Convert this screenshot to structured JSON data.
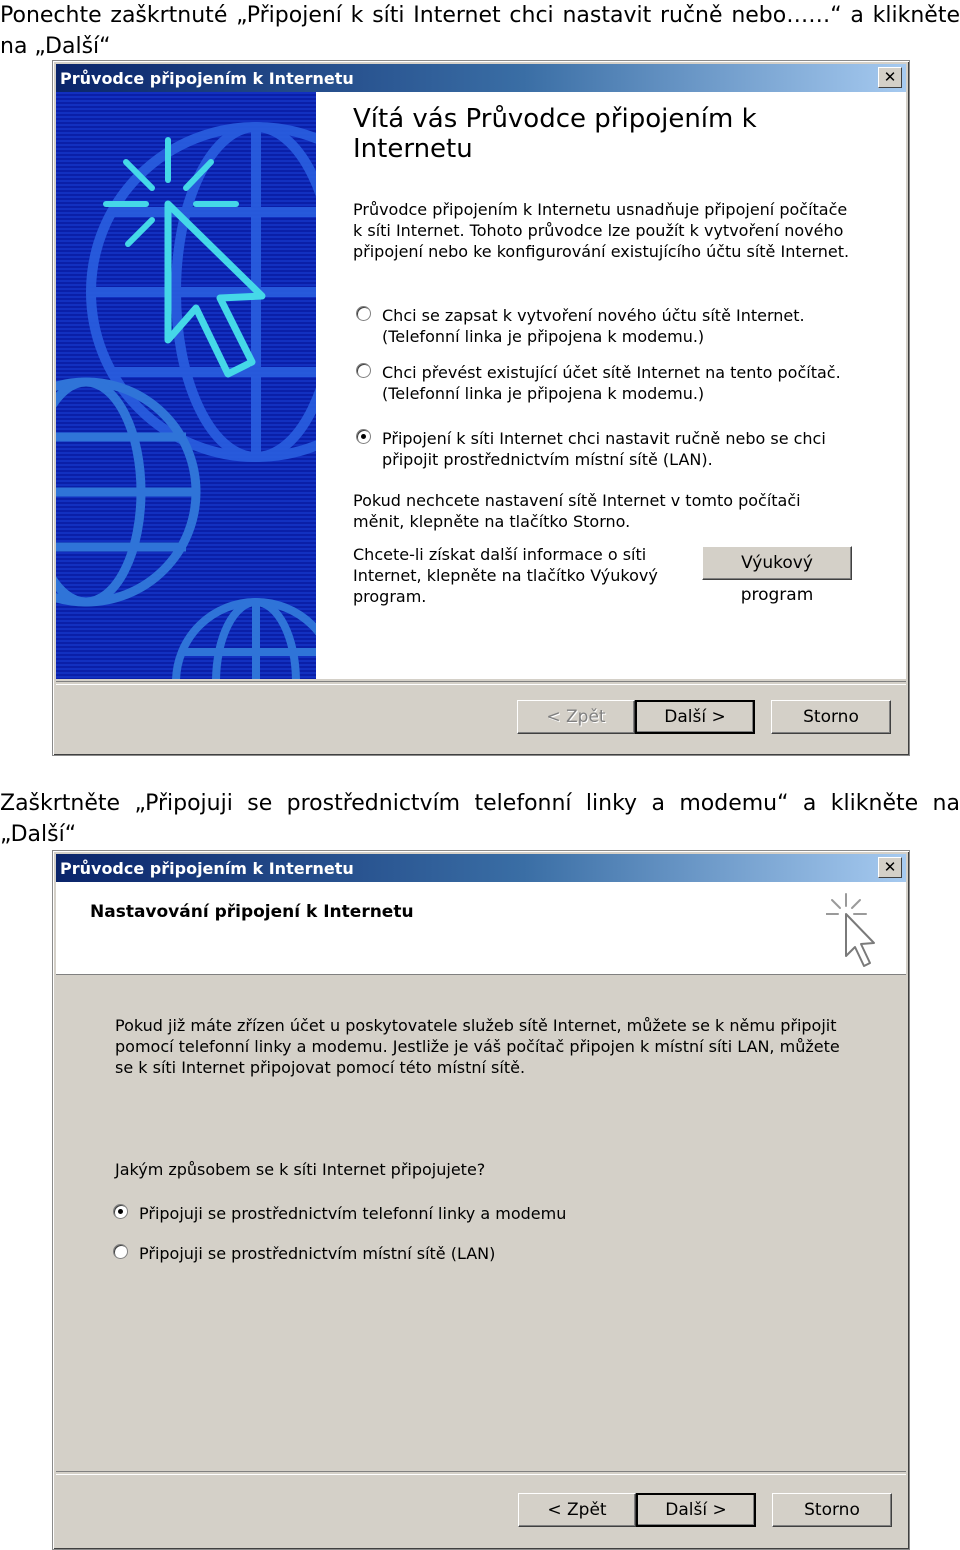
{
  "captions": {
    "first": "Ponechte zaškrtnuté „Připojení k síti Internet chci nastavit ručně nebo……“ a klikněte na „Další“",
    "second": "Zaškrtněte „Připojuji se prostřednictvím telefonní linky a modemu“ a klikněte na „Další“"
  },
  "window1": {
    "title": "Průvodce připojením k Internetu",
    "close": "✕",
    "heading": "Vítá vás Průvodce připojením k Internetu",
    "intro": "Průvodce připojením k Internetu usnadňuje připojení počítače k síti Internet. Tohoto průvodce lze použít k vytvoření nového připojení nebo ke konfigurování existujícího účtu sítě Internet.",
    "options": [
      {
        "line1": "Chci se zapsat k vytvoření nového účtu sítě Internet.",
        "line2": "(Telefonní linka je připojena k modemu.)",
        "selected": false
      },
      {
        "line1": "Chci převést existující účet sítě Internet na tento počítač.",
        "line2": "(Telefonní linka je připojena k modemu.)",
        "selected": false
      },
      {
        "line1": "Připojení k síti Internet chci nastavit ručně nebo se chci",
        "line2": "připojit prostřednictvím místní sítě (LAN).",
        "selected": true
      }
    ],
    "cancel_note": "Pokud nechcete nastavení sítě Internet v tomto počítači měnit, klepněte na tlačítko Storno.",
    "tutorial_note": "Chcete-li získat další informace o síti Internet, klepněte na tlačítko Výukový program.",
    "tutorial_button": "Výukový program",
    "buttons": {
      "back": "< Zpět",
      "next": "Další >",
      "cancel": "Storno"
    }
  },
  "window2": {
    "title": "Průvodce připojením k Internetu",
    "close": "✕",
    "header": "Nastavování připojení k Internetu",
    "description": "Pokud již máte zřízen účet u poskytovatele služeb sítě Internet, můžete se k němu připojit pomocí telefonní linky a modemu. Jestliže je váš počítač připojen k místní síti LAN, můžete se k síti Internet připojovat pomocí této místní sítě.",
    "question": "Jakým způsobem se k síti Internet připojujete?",
    "options": [
      {
        "label": "Připojuji se prostřednictvím telefonní linky a modemu",
        "selected": true
      },
      {
        "label": "Připojuji se prostřednictvím místní sítě (LAN)",
        "selected": false
      }
    ],
    "buttons": {
      "back": "< Zpět",
      "next": "Další >",
      "cancel": "Storno"
    }
  },
  "colors": {
    "titlebar_start": "#0a246a",
    "titlebar_end": "#a6caf0",
    "sidebar": "#0a1fa8",
    "dialog_face": "#d4d0c8"
  }
}
